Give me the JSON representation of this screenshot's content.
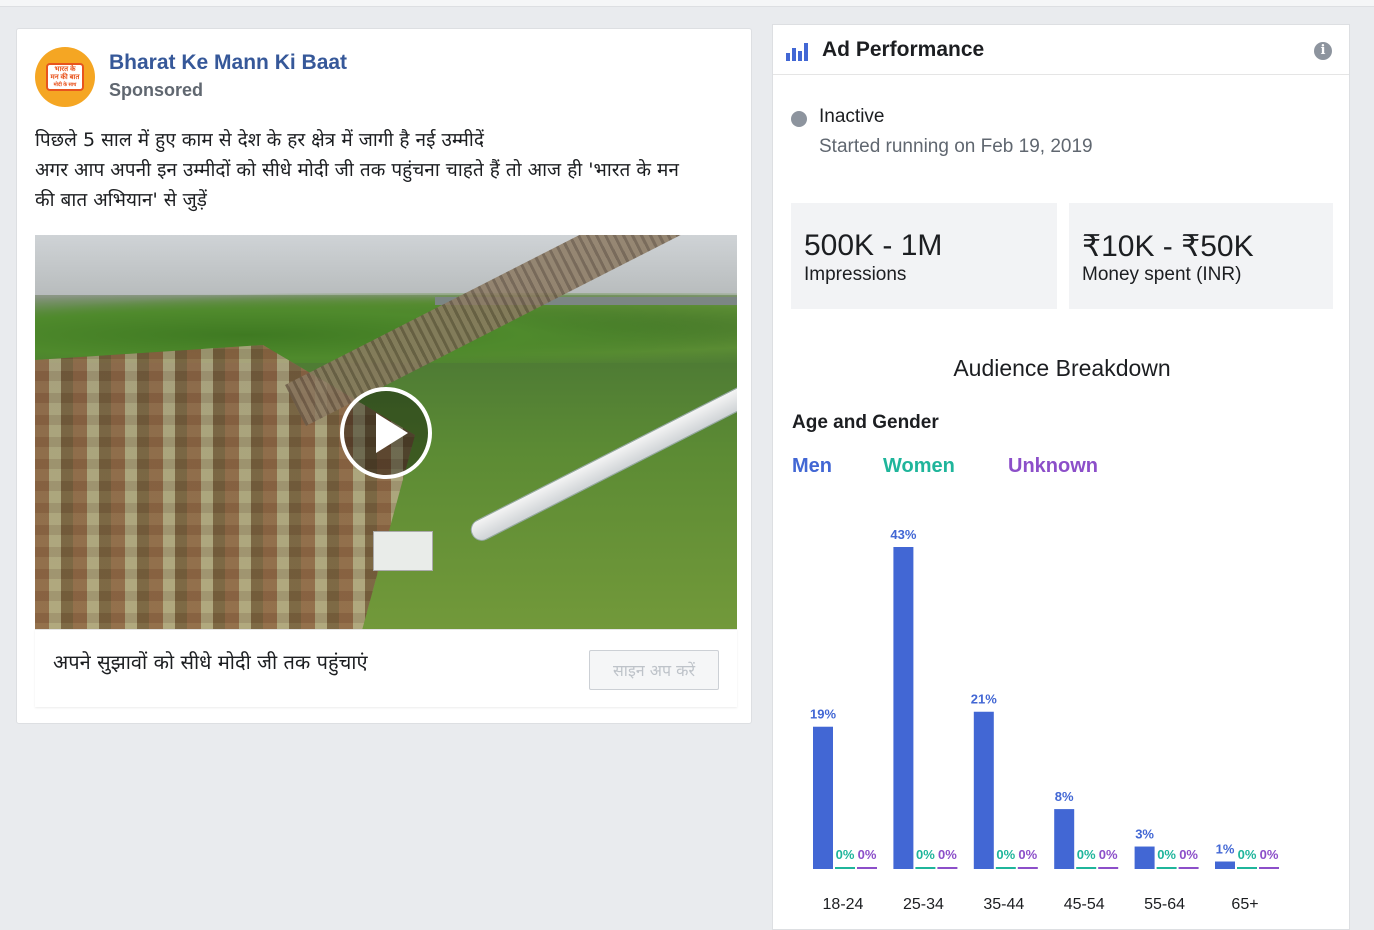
{
  "ad": {
    "page_name": "Bharat Ke Mann Ki Baat",
    "sponsored": "Sponsored",
    "logo_lines": [
      "भारत के",
      "मन की बात",
      "मोदी के साथ"
    ],
    "text_lines": [
      "पिछले 5 साल में हुए काम से देश के हर क्षेत्र में जागी है नई उम्मीदें",
      "अगर आप अपनी इन उम्मीदों को सीधे मोदी जी तक पहुंचना चाहते हैं तो आज ही 'भारत के मन",
      "की बात अभियान' से जुड़ें"
    ],
    "cta_text": "अपने सुझावों को सीधे मोदी जी तक पहुंचाएं",
    "cta_button": "साइन अप करें",
    "play_icon": "play-icon"
  },
  "performance": {
    "title": "Ad Performance",
    "status": "Inactive",
    "started": "Started running on Feb 19, 2019",
    "impressions_value": "500K - 1M",
    "impressions_label": "Impressions",
    "spent_value": "₹10K - ₹50K",
    "spent_label": "Money spent (INR)",
    "audience_title": "Audience Breakdown",
    "age_gender_title": "Age and Gender",
    "legend": [
      {
        "name": "Men",
        "color": "#4267d4"
      },
      {
        "name": "Women",
        "color": "#1fb59b"
      },
      {
        "name": "Unknown",
        "color": "#8c4fc9"
      }
    ],
    "colors": {
      "status_dot": "#8d949e",
      "icon": "#4267d4"
    }
  },
  "chart_data": {
    "type": "bar",
    "categories": [
      "18-24",
      "25-34",
      "35-44",
      "45-54",
      "55-64",
      "65+"
    ],
    "series": [
      {
        "name": "Men",
        "values": [
          19,
          43,
          21,
          8,
          3,
          1
        ],
        "labels": [
          "19%",
          "43%",
          "21%",
          "8%",
          "3%",
          "1%"
        ]
      },
      {
        "name": "Women",
        "values": [
          0,
          0,
          0,
          0,
          0,
          0
        ],
        "labels": [
          "0%",
          "0%",
          "0%",
          "0%",
          "0%",
          "0%"
        ]
      },
      {
        "name": "Unknown",
        "values": [
          0,
          0,
          0,
          0,
          0,
          0
        ],
        "labels": [
          "0%",
          "0%",
          "0%",
          "0%",
          "0%",
          "0%"
        ]
      }
    ],
    "ylim": [
      0,
      43
    ],
    "grid": false,
    "legend": "top-left"
  }
}
